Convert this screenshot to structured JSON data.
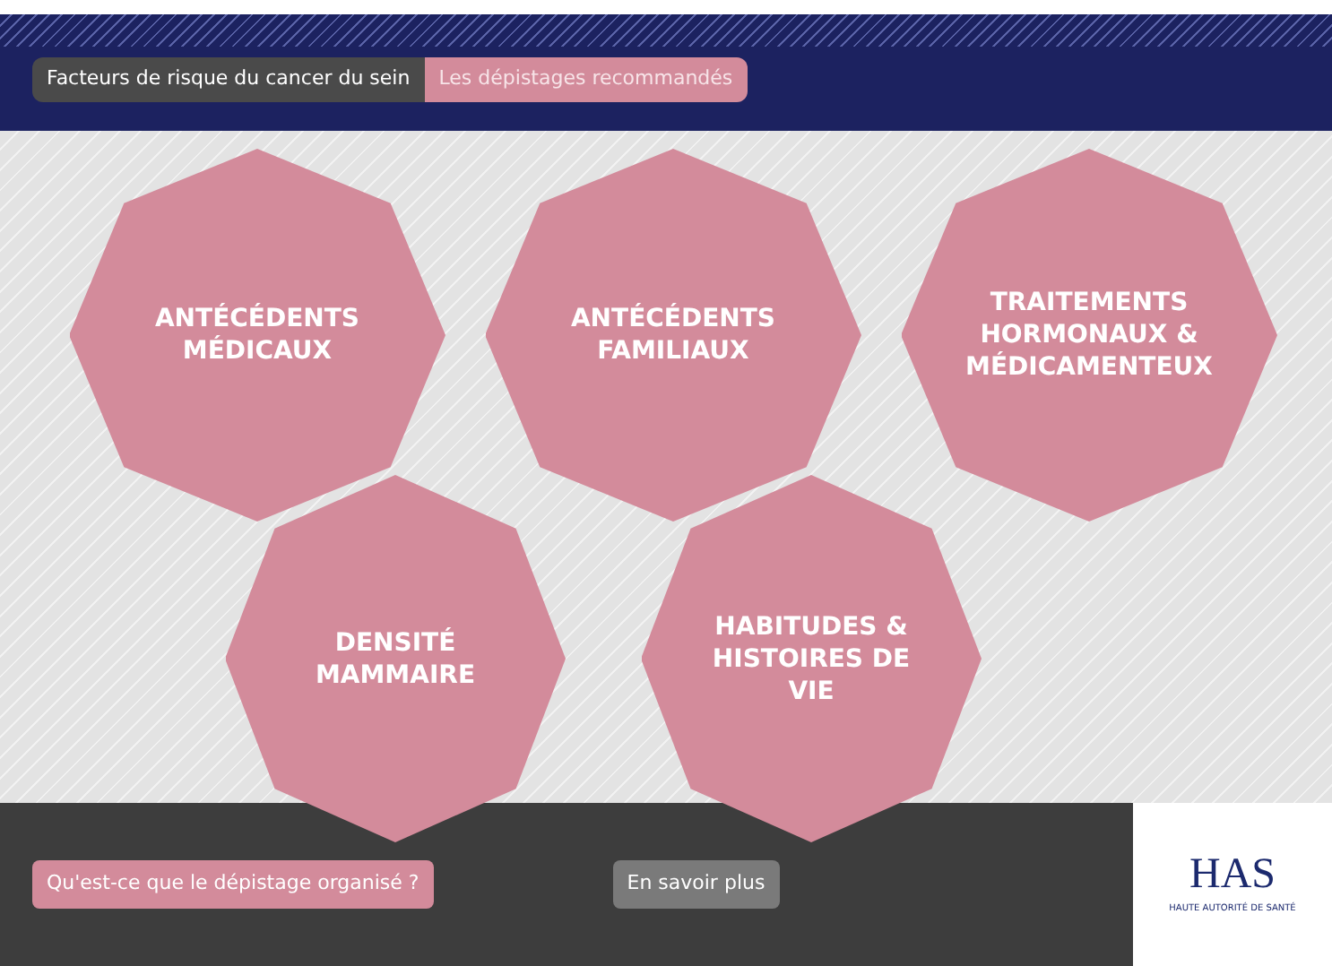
{
  "breadcrumb": [
    {
      "label": "Facteurs de risque du cancer du sein",
      "selected": false
    },
    {
      "label": "Les dépistages recommandés",
      "selected": true
    }
  ],
  "topics": [
    {
      "label": "ANTÉCÉDENTS MÉDICAUX"
    },
    {
      "label": "ANTÉCÉDENTS FAMILIAUX"
    },
    {
      "label": "TRAITEMENTS HORMONAUX & MÉDICAMENTEUX"
    },
    {
      "label": "DENSITÉ MAMMAIRE"
    },
    {
      "label": "HABITUDES & HISTOIRES DE VIE"
    }
  ],
  "footer": {
    "buttons": [
      {
        "label": "Qu'est-ce que le dépistage organisé ?",
        "kind": "primary"
      },
      {
        "label": "En savoir plus",
        "kind": "secondary"
      }
    ],
    "logo": {
      "mark": "HAS",
      "subtitle": "HAUTE AUTORITÉ DE SANTÉ"
    }
  }
}
